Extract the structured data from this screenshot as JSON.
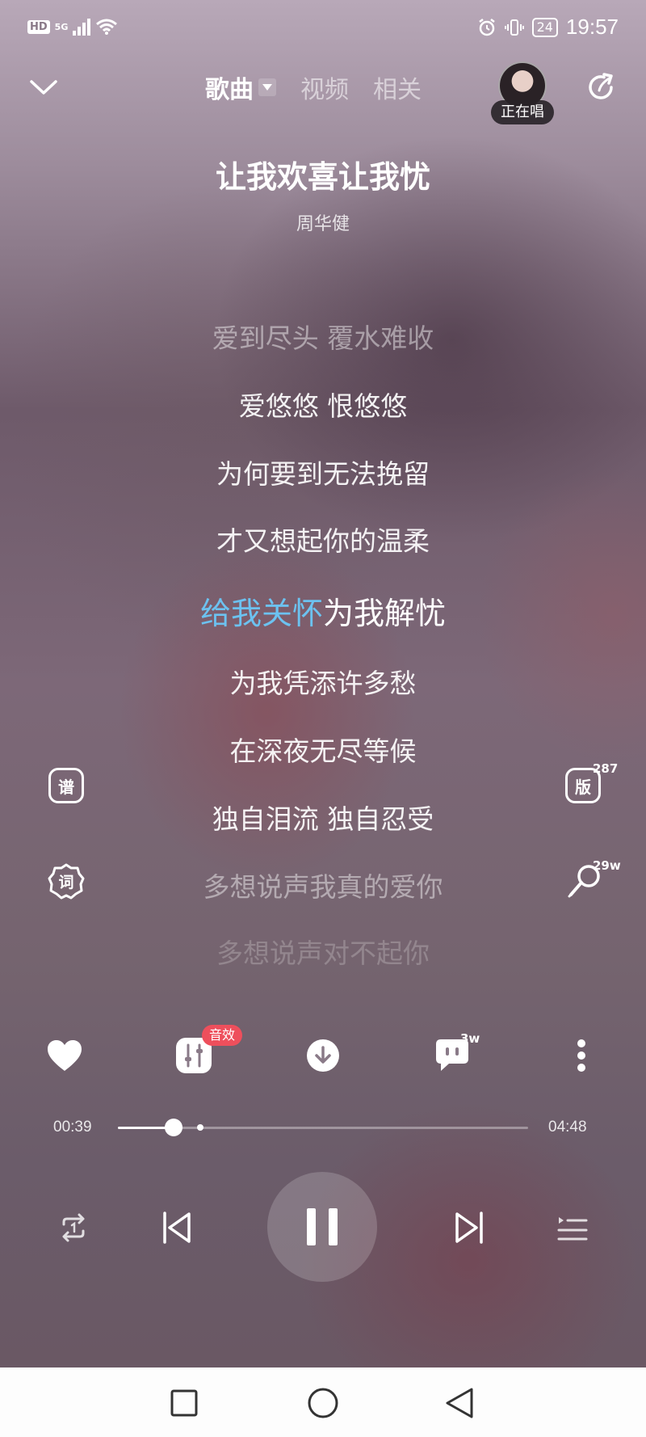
{
  "status_bar": {
    "hd": "HD",
    "network": "5G",
    "battery": "24",
    "time": "19:57"
  },
  "header": {
    "tabs": [
      {
        "label": "歌曲",
        "active": true
      },
      {
        "label": "视频",
        "active": false
      },
      {
        "label": "相关",
        "active": false
      }
    ],
    "singing_badge": "正在唱"
  },
  "song": {
    "title": "让我欢喜让我忧",
    "artist": "周华健"
  },
  "lyrics": {
    "lines": [
      "爱到尽头 覆水难收",
      "爱悠悠 恨悠悠",
      "为何要到无法挽留",
      "才又想起你的温柔",
      "给我关怀为我解忧",
      "为我凭添许多愁",
      "在深夜无尽等候",
      "独自泪流 独自忍受",
      "多想说声我真的爱你",
      "多想说声对不起你"
    ],
    "active_sung": "给我关怀",
    "active_rest": "为我解忧"
  },
  "side": {
    "score_label": "谱",
    "version_label": "版",
    "version_count": "287",
    "lyrics_label": "词",
    "sing_count": "29w"
  },
  "actions": {
    "sound_effect_badge": "音效",
    "comment_count": "3w"
  },
  "progress": {
    "current": "00:39",
    "total": "04:48",
    "fraction": 0.135,
    "highlight_fraction": 0.2
  },
  "colors": {
    "sung_lyric": "#6cc2f0",
    "badge_red": "#ee4f5c"
  }
}
